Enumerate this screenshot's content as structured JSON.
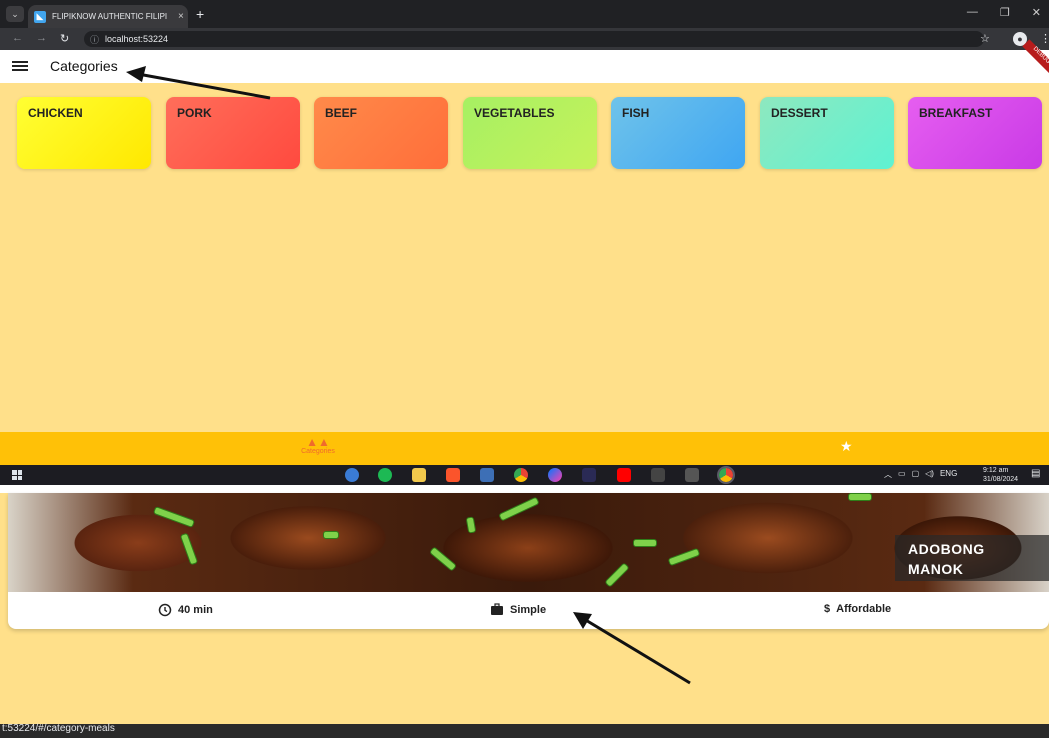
{
  "browser": {
    "tab_title": "FLIPIKNOW AUTHENTIC FILIPI",
    "tab_close": "×",
    "new_tab": "+",
    "url": "localhost:53224",
    "window_controls": [
      "—",
      "❐",
      "✕"
    ]
  },
  "appbar": {
    "title": "Categories",
    "debug_banner": "DEBUG"
  },
  "categories": [
    {
      "label": "CHICKEN",
      "from": "#ffff33",
      "to": "#ffe800"
    },
    {
      "label": "PORK",
      "from": "#ff6e5a",
      "to": "#ff4a3f"
    },
    {
      "label": "BEEF",
      "from": "#ff8a4a",
      "to": "#ff6e3a"
    },
    {
      "label": "VEGETABLES",
      "from": "#a6f063",
      "to": "#c6f25a"
    },
    {
      "label": "FISH",
      "from": "#6fc3ea",
      "to": "#3fa6f2"
    },
    {
      "label": "DESSERT",
      "from": "#8ee8bf",
      "to": "#5ef2d2"
    },
    {
      "label": "BREAKFAST",
      "from": "#e65ef0",
      "to": "#c93ae6"
    }
  ],
  "bottom_nav": {
    "categories_label": "Categories",
    "categories_icon": "categories-icon",
    "favorites_icon": "star-icon"
  },
  "taskbar": {
    "language": "ENG",
    "time": "9:12 am",
    "date": "31/08/2024"
  },
  "meal": {
    "title_line1": "ADOBONG",
    "title_line2": "MANOK",
    "duration": "40 min",
    "complexity": "Simple",
    "affordability": "Affordable",
    "dollar_sign": "$"
  },
  "status_url": "t:53224/#/category-meals",
  "colors": {
    "background": "#ffe08a",
    "bottom_nav": "#ffc107",
    "nav_active": "#f06a2c"
  }
}
